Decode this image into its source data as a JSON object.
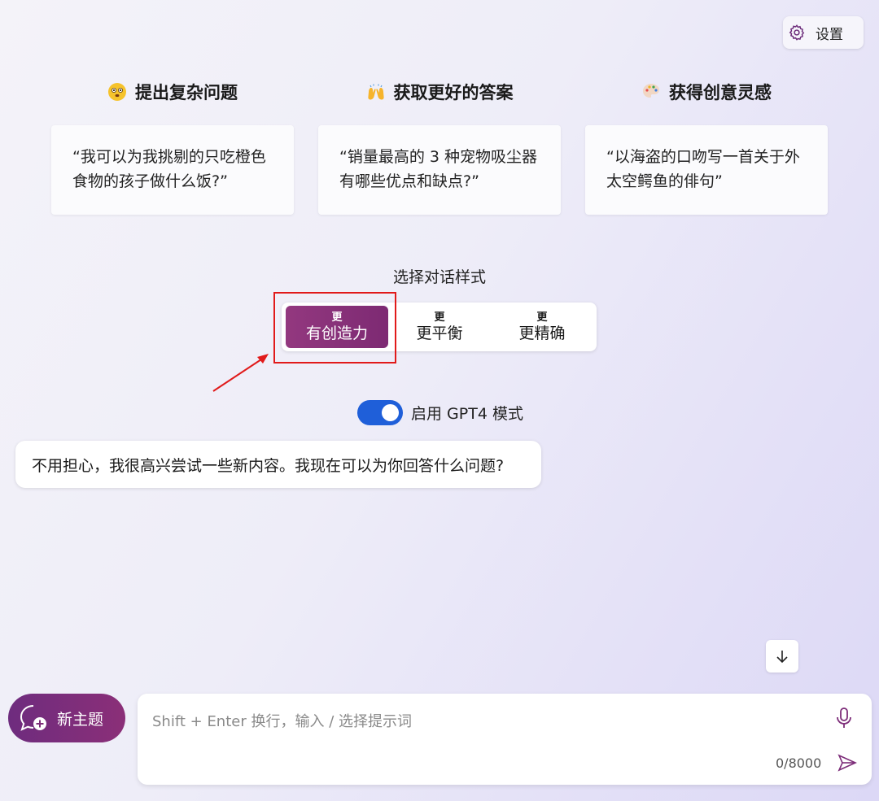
{
  "settings": {
    "label": "设置",
    "icon": "gear-icon"
  },
  "features": [
    {
      "icon": "thinking-face-icon",
      "title": "提出复杂问题",
      "card": "“我可以为我挑剔的只吃橙色食物的孩子做什么饭?”"
    },
    {
      "icon": "raised-hands-icon",
      "title": "获取更好的答案",
      "card": "“销量最高的 3 种宠物吸尘器有哪些优点和缺点?”"
    },
    {
      "icon": "palette-icon",
      "title": "获得创意灵感",
      "card": "“以海盗的口吻写一首关于外太空鳄鱼的俳句”"
    }
  ],
  "conversation_style": {
    "label": "选择对话样式",
    "options": [
      {
        "small": "更",
        "big": "有创造力",
        "selected": true
      },
      {
        "small": "更",
        "big": "更平衡",
        "selected": false
      },
      {
        "small": "更",
        "big": "更精确",
        "selected": false
      }
    ]
  },
  "gpt4_toggle": {
    "label": "启用 GPT4 模式",
    "enabled": true
  },
  "message": {
    "text": "不用担心，我很高兴尝试一些新内容。我现在可以为你回答什么问题?"
  },
  "new_topic": {
    "label": "新主题"
  },
  "input": {
    "placeholder": "Shift + Enter 换行，输入 / 选择提示词",
    "value": "",
    "counter": "0/8000"
  },
  "colors": {
    "accent": "#8b2f78",
    "toggle": "#1f5fd9",
    "highlight": "#e11a1a"
  }
}
